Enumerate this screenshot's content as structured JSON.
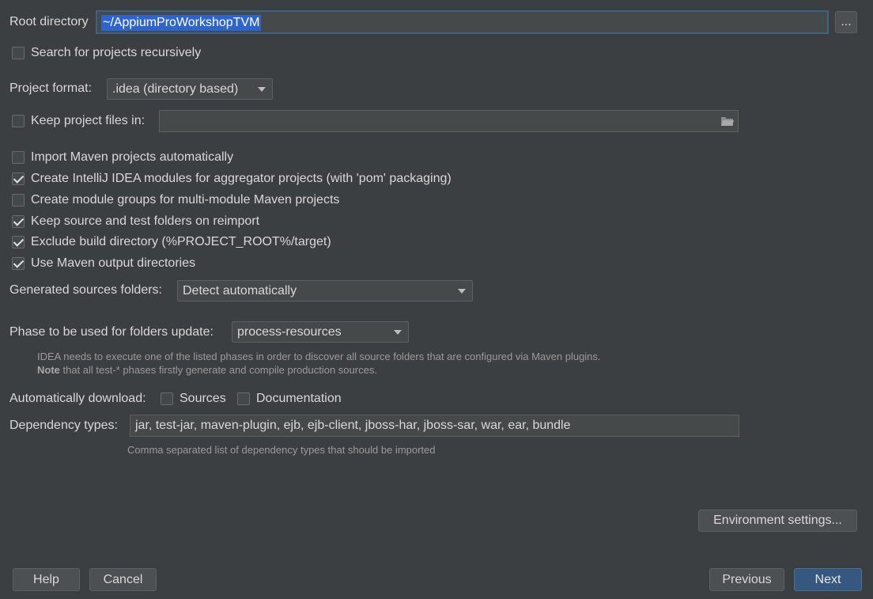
{
  "root": {
    "label": "Root directory",
    "value": "~/AppiumProWorkshopTVM",
    "browse_label": "..."
  },
  "search_recursive": {
    "label": "Search for projects recursively",
    "checked": false
  },
  "project_format": {
    "label": "Project format:",
    "value": ".idea (directory based)"
  },
  "keep_files": {
    "label": "Keep project files in:",
    "checked": false,
    "value": ""
  },
  "options": [
    {
      "label": "Import Maven projects automatically",
      "checked": false
    },
    {
      "label": "Create IntelliJ IDEA modules for aggregator projects (with 'pom' packaging)",
      "checked": true
    },
    {
      "label": "Create module groups for multi-module Maven projects",
      "checked": false
    },
    {
      "label": "Keep source and test folders on reimport",
      "checked": true
    },
    {
      "label": "Exclude build directory (%PROJECT_ROOT%/target)",
      "checked": true
    },
    {
      "label": "Use Maven output directories",
      "checked": true
    }
  ],
  "generated_sources": {
    "label": "Generated sources folders:",
    "value": "Detect automatically"
  },
  "phase": {
    "label": "Phase to be used for folders update:",
    "value": "process-resources",
    "hint_line1": "IDEA needs to execute one of the listed phases in order to discover all source folders that are configured via Maven plugins.",
    "hint_note": "Note",
    "hint_line2": " that all test-* phases firstly generate and compile production sources."
  },
  "auto_download": {
    "label": "Automatically download:",
    "sources_label": "Sources",
    "sources_checked": false,
    "docs_label": "Documentation",
    "docs_checked": false
  },
  "dependency_types": {
    "label": "Dependency types:",
    "value": "jar, test-jar, maven-plugin, ejb, ejb-client, jboss-har, jboss-sar, war, ear, bundle",
    "hint": "Comma separated list of dependency types that should be imported"
  },
  "buttons": {
    "environment": "Environment settings...",
    "help": "Help",
    "cancel": "Cancel",
    "previous": "Previous",
    "next": "Next"
  },
  "colors": {
    "background": "#3c3f41",
    "selection": "#2f65ca",
    "default_button": "#365880"
  }
}
